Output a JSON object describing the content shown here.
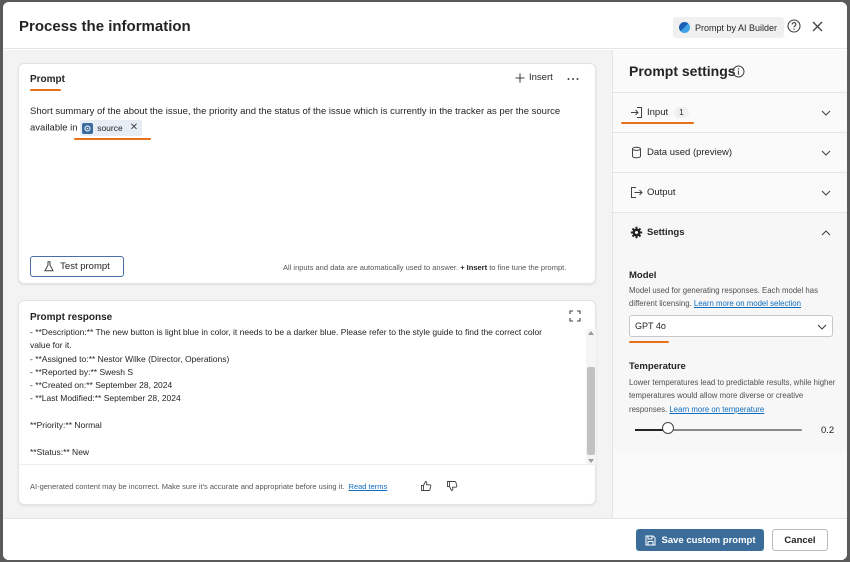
{
  "dialog": {
    "title": "Process the information",
    "badge_label": "Prompt by AI Builder"
  },
  "prompt": {
    "tab_label": "Prompt",
    "insert_label": "Insert",
    "text_line1": "Short summary of the about the issue,  the priority and the status of the issue which is currently in the tracker as per the source",
    "text_line2": "available in",
    "chip_label": "source",
    "test_button": "Test prompt",
    "hint_pre": "All inputs and data are automatically used to answer.",
    "hint_insert": "+ Insert",
    "hint_post": "to fine tune the prompt."
  },
  "response": {
    "title": "Prompt response",
    "lines": [
      "- **Description:** The new button is light blue in color, it needs to be a darker blue. Please refer to the style guide to find the correct color",
      "value for it.",
      "- **Assigned to:** Nestor Wilke (Director, Operations)",
      "- **Reported by:** Swesh S",
      "- **Created on:** September 28, 2024",
      "- **Last Modified:** September 28, 2024",
      "",
      "**Priority:** Normal",
      "",
      "**Status:** New"
    ],
    "disclaimer": "AI-generated content may be incorrect. Make sure it's accurate and appropriate before using it.",
    "read_terms": "Read terms"
  },
  "settings": {
    "title": "Prompt settings",
    "sections": {
      "input": {
        "label": "Input",
        "count": "1"
      },
      "data": {
        "label": "Data used (preview)"
      },
      "output": {
        "label": "Output"
      },
      "settings": {
        "label": "Settings"
      }
    },
    "model": {
      "title": "Model",
      "desc": "Model used for generating responses. Each model has different licensing.",
      "link": "Learn more on model selection",
      "value": "GPT 4o"
    },
    "temperature": {
      "title": "Temperature",
      "desc": "Lower temperatures lead to predictable results, while higher temperatures would allow more diverse or creative responses.",
      "link": "Learn more on temperature",
      "value": 0.2,
      "value_label": "0.2"
    }
  },
  "footer": {
    "save_label": "Save custom prompt",
    "cancel_label": "Cancel"
  },
  "colors": {
    "accent_orange": "#e8701a",
    "primary_blue": "#3c6d9a",
    "link_blue": "#0f6cbd"
  }
}
